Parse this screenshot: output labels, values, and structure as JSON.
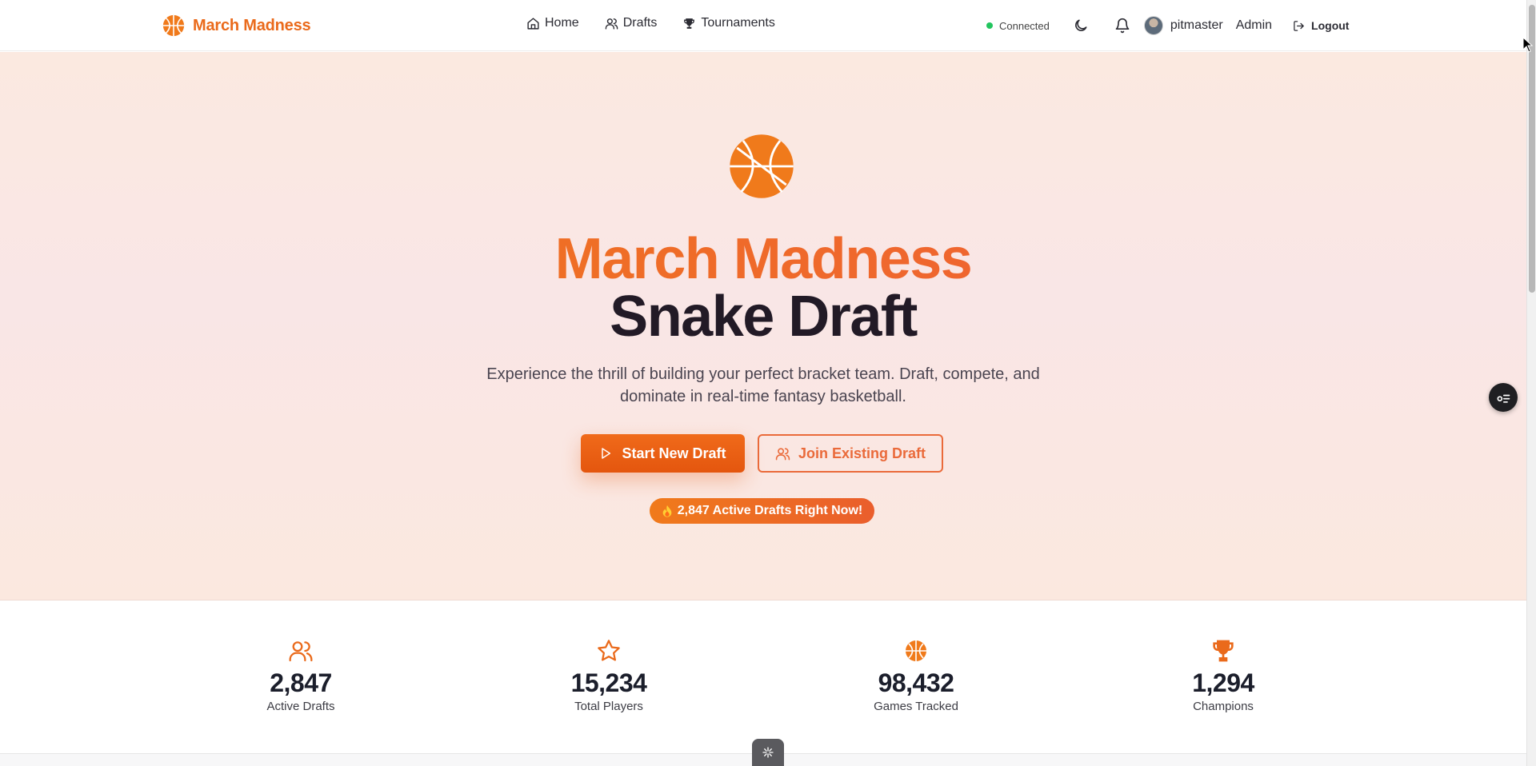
{
  "header": {
    "brand": "March Madness",
    "nav": [
      {
        "label": "Home",
        "icon": "home-icon"
      },
      {
        "label": "Drafts",
        "icon": "users-icon"
      },
      {
        "label": "Tournaments",
        "icon": "trophy-icon"
      }
    ],
    "status": "Connected",
    "username": "pitmaster",
    "admin_label": "Admin",
    "logout_label": "Logout"
  },
  "hero": {
    "title_line1": "March Madness",
    "title_line2": "Snake Draft",
    "subtitle": "Experience the thrill of building your perfect bracket team. Draft, compete, and dominate in real-time fantasy basketball.",
    "primary_button": "Start New Draft",
    "secondary_button": "Join Existing Draft",
    "active_badge": "2,847 Active Drafts Right Now!"
  },
  "stats": [
    {
      "value": "2,847",
      "label": "Active Drafts",
      "icon": "users-icon"
    },
    {
      "value": "15,234",
      "label": "Total Players",
      "icon": "star-icon"
    },
    {
      "value": "98,432",
      "label": "Games Tracked",
      "icon": "basketball-icon"
    },
    {
      "value": "1,294",
      "label": "Champions",
      "icon": "trophy-icon"
    }
  ],
  "colors": {
    "brand_orange": "#ea6a1b",
    "accent_coral": "#ea6a3a",
    "status_green": "#22c55e"
  }
}
